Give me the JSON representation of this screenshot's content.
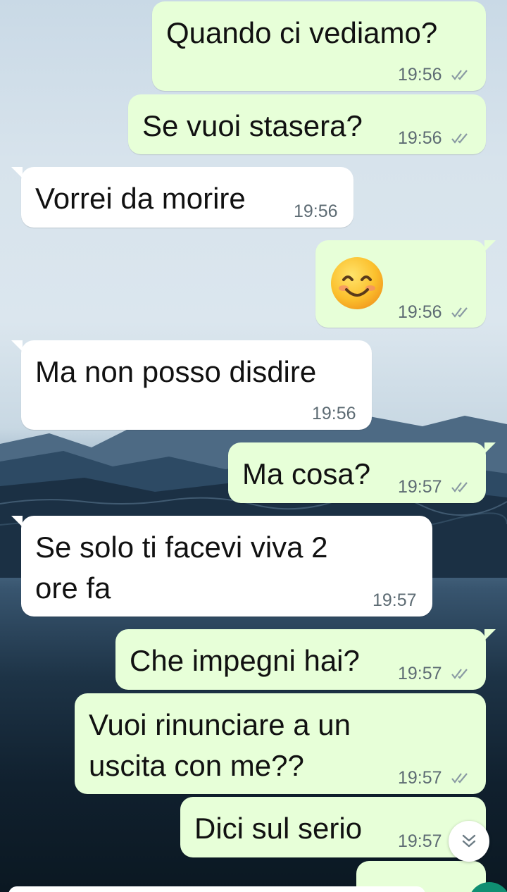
{
  "chat": {
    "messages": [
      {
        "text": "Quando ci vediamo?",
        "time": "19:56",
        "direction": "outgoing",
        "status": "read"
      },
      {
        "text": "Se vuoi stasera?",
        "time": "19:56",
        "direction": "outgoing",
        "status": "read"
      },
      {
        "text": "Vorrei da morire",
        "time": "19:56",
        "direction": "incoming"
      },
      {
        "emoji": "smiling-face-with-smiling-eyes",
        "time": "19:56",
        "direction": "outgoing",
        "status": "read"
      },
      {
        "text": "Ma non posso disdire",
        "time": "19:56",
        "direction": "incoming"
      },
      {
        "text": "Ma cosa?",
        "time": "19:57",
        "direction": "outgoing",
        "status": "read"
      },
      {
        "text": "Se solo ti facevi viva 2\nore fa",
        "time": "19:57",
        "direction": "incoming"
      },
      {
        "text": "Che impegni hai?",
        "time": "19:57",
        "direction": "outgoing",
        "status": "read"
      },
      {
        "text": "Vuoi rinunciare a un\nuscita con me??",
        "time": "19:57",
        "direction": "outgoing",
        "status": "read"
      },
      {
        "text": "Dici sul serio",
        "time": "19:57",
        "direction": "outgoing",
        "status": "read"
      }
    ]
  },
  "icons": {
    "read_receipt": "double-check-icon",
    "scroll_down": "chevron-double-down-icon",
    "emoji": "smiling-face-with-smiling-eyes"
  },
  "colors": {
    "outgoing_bubble": "#e7ffd8",
    "incoming_bubble": "#ffffff",
    "timestamp": "#5d6b73",
    "read_check": "#8a9aa3"
  }
}
